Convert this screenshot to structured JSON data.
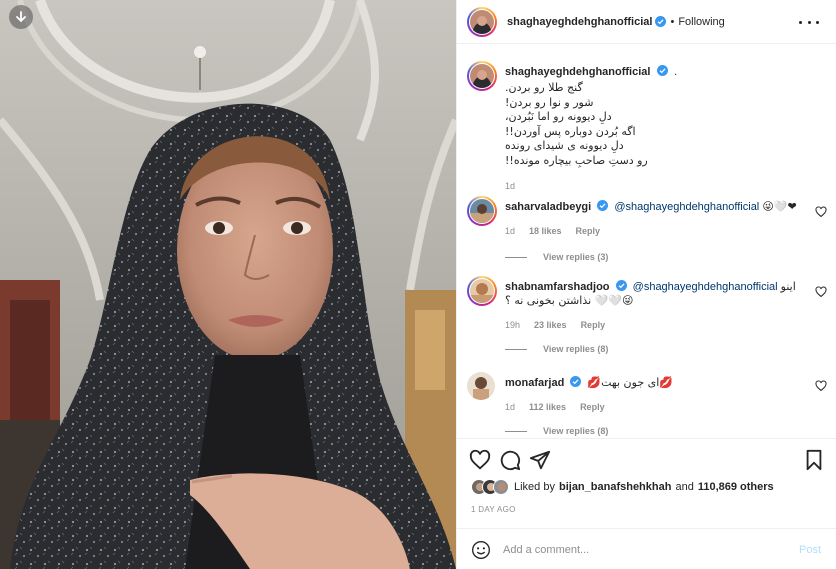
{
  "media": {
    "download_icon": "arrow-down-icon"
  },
  "post_header": {
    "username": "shaghayeghdehghanofficial",
    "separator": "•",
    "follow_status": "Following",
    "more_icon": "more-horizontal-icon"
  },
  "caption": {
    "username": "shaghayeghdehghanofficial",
    "suffix": ".",
    "lines": [
      "گنج طلا رو بردن.",
      "شور و نوا رو بردن!",
      "دلِ دیوونه رو اما نَبُردن،",
      "اگه بُردن دوباره پس آوردن!!",
      "دلِ دیوونه ی شیدای رونده",
      "رو دستِ صاحبِ بیچاره مونده!!"
    ],
    "age": "1d"
  },
  "comments": [
    {
      "username": "saharvaladbeygi",
      "mention": "@shaghayeghdehghanofficial",
      "text": "😜🤍❤",
      "age": "1d",
      "likes": "18 likes",
      "reply": "Reply",
      "view_replies": "View replies (3)"
    },
    {
      "username": "shabnamfarshadjoo",
      "mention": "@shaghayeghdehghanofficial",
      "text_before": "اینو",
      "text_line2": "نذاشتن بخونی نه ؟ 🤍🤍😜",
      "age": "19h",
      "likes": "23 likes",
      "reply": "Reply",
      "view_replies": "View replies (8)"
    },
    {
      "username": "monafarjad",
      "text": "💋ای جون بهت💋",
      "age": "1d",
      "likes": "112 likes",
      "reply": "Reply",
      "view_replies": "View replies (8)"
    }
  ],
  "actions": {
    "like_icon": "heart-icon",
    "comment_icon": "comment-icon",
    "share_icon": "send-icon",
    "save_icon": "bookmark-icon"
  },
  "likes": {
    "prefix": "Liked by",
    "user": "bijan_banafshehkhah",
    "middle": "and",
    "count": "110,869 others"
  },
  "timestamp": "1 DAY AGO",
  "add_comment": {
    "placeholder": "Add a comment...",
    "post_label": "Post",
    "emoji_icon": "smiley-icon"
  },
  "colors": {
    "verified_blue": "#3897f0",
    "link_blue": "#00376b",
    "muted": "#8e8e8e",
    "post_button": "#b2dffc"
  }
}
